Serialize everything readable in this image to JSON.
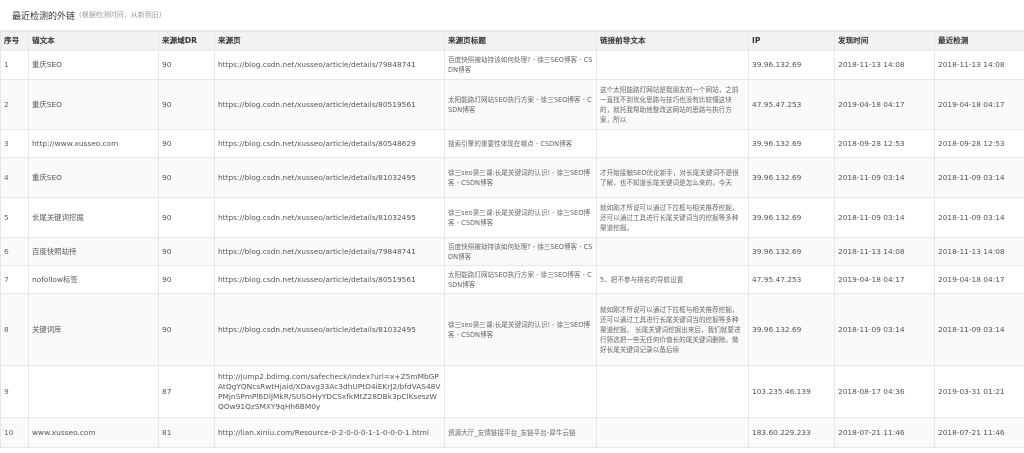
{
  "header": {
    "title": "最近检测的外链",
    "note": "(根据检测时间，从新到旧)"
  },
  "table": {
    "columns": [
      "序号",
      "锚文本",
      "来源域DR",
      "来源页",
      "来源页标题",
      "链接前导文本",
      "IP",
      "发现时间",
      "最近检测"
    ],
    "rows": [
      {
        "no": "1",
        "anchor": "重庆SEO",
        "dr": "90",
        "url": "https://blog.csdn.net/xusseo/article/details/79848741",
        "title": "百度快照被劫持该如何处理? - 徐三SEO博客 - CSDN博客",
        "lead": "",
        "ip": "39.96.132.69",
        "found": "2018-11-13 14:08",
        "last": "2018-11-13 14:08"
      },
      {
        "no": "2",
        "anchor": "重庆SEO",
        "dr": "90",
        "url": "https://blog.csdn.net/xusseo/article/details/80519561",
        "title": "太阳能路灯网站SEO执行方案 - 徐三SEO博客 - CSDN博客",
        "lead": "这个太阳能路灯网站是我朋友的一个网站，之前一直找不到优化思路与技巧也没有比较懂这块的，就托我帮助他整改这网站的思路与执行方案，所以",
        "ip": "47.95.47.253",
        "found": "2019-04-18 04:17",
        "last": "2019-04-18 04:17"
      },
      {
        "no": "3",
        "anchor": "http://www.xusseo.com",
        "dr": "90",
        "url": "https://blog.csdn.net/xusseo/article/details/80548629",
        "title": "搜索引擎的重要性体现在哪点 - CSDN博客",
        "lead": "",
        "ip": "39.96.132.69",
        "found": "2018-09-28 12:53",
        "last": "2018-09-28 12:53"
      },
      {
        "no": "4",
        "anchor": "重庆SEO",
        "dr": "90",
        "url": "https://blog.csdn.net/xusseo/article/details/81032495",
        "title": "徐三seo第三课:长尾关键词的认识! - 徐三SEO博客 - CSDN博客",
        "lead": "才开始接触SEO优化新手，对长尾关键词不是很了解，也不知道长尾关键词是怎么来的，今天",
        "ip": "39.96.132.69",
        "found": "2018-11-09 03:14",
        "last": "2018-11-09 03:14"
      },
      {
        "no": "5",
        "anchor": "长尾关键词挖掘",
        "dr": "90",
        "url": "https://blog.csdn.net/xusseo/article/details/81032495",
        "title": "徐三seo第三课:长尾关键词的认识! - 徐三SEO博客 - CSDN博客",
        "lead": "就如刚才所说可以通过下拉框与相关推荐挖掘，还可以通过工具进行长尾关键词当的挖掘等多种渠道挖掘。",
        "ip": "39.96.132.69",
        "found": "2018-11-09 03:14",
        "last": "2018-11-09 03:14"
      },
      {
        "no": "6",
        "anchor": "百度快照劫持",
        "dr": "90",
        "url": "https://blog.csdn.net/xusseo/article/details/79848741",
        "title": "百度快照被劫持该如何处理? - 徐三SEO博客 - CSDN博客",
        "lead": "",
        "ip": "39.96.132.69",
        "found": "2018-11-13 14:08",
        "last": "2018-11-13 14:08"
      },
      {
        "no": "7",
        "anchor": "nofollow标签",
        "dr": "90",
        "url": "https://blog.csdn.net/xusseo/article/details/80519561",
        "title": "太阳能路灯网站SEO执行方案 - 徐三SEO博客 - CSDN博客",
        "lead": "5、把不参与排名的导航设置",
        "ip": "47.95.47.253",
        "found": "2019-04-18 04:17",
        "last": "2019-04-18 04:17"
      },
      {
        "no": "8",
        "anchor": "关键词库",
        "dr": "90",
        "url": "https://blog.csdn.net/xusseo/article/details/81032495",
        "title": "徐三seo第三课:长尾关键词的认识! - 徐三SEO博客 - CSDN博客",
        "lead": "就如刚才所说可以通过下拉框与相关推荐挖掘，还可以通过工具进行长尾关键词当的挖掘等多种渠道挖掘。 长尾关键词挖掘出来后，我们就要进行筛选把一些无任何价值长的尾关键词删除。做好长尾关键词记录以备后续",
        "ip": "39.96.132.69",
        "found": "2018-11-09 03:14",
        "last": "2018-11-09 03:14"
      },
      {
        "no": "9",
        "anchor": "",
        "dr": "87",
        "url": "http://jump2.bdimg.com/safecheck/index?url=x+Z5mMbGPAtQgYQNcsRwtHjaid/XDavg33Ac3dhUPtO4iEKrJ2/bfdVAS48VPMjnSPmPl6DlJMkR/SUSOHyYDCSxfkMtZ28DBk3pClKseszWQOw91QzSMXY9qHh6BM0y",
        "title": "",
        "lead": "",
        "ip": "103.235.46.139",
        "found": "2018-08-17 04:36",
        "last": "2019-03-31 01:21"
      },
      {
        "no": "10",
        "anchor": "www.xusseo.com",
        "dr": "81",
        "url": "http://lian.xiniu.com/Resource-0-2-0-0-0-1-1-0-0-0-1.html",
        "title": "资源大厅_友情链接平台_友链平台-犀牛云链",
        "lead": "",
        "ip": "183.60.229.233",
        "found": "2018-07-21 11:46",
        "last": "2018-07-21 11:46"
      }
    ]
  }
}
